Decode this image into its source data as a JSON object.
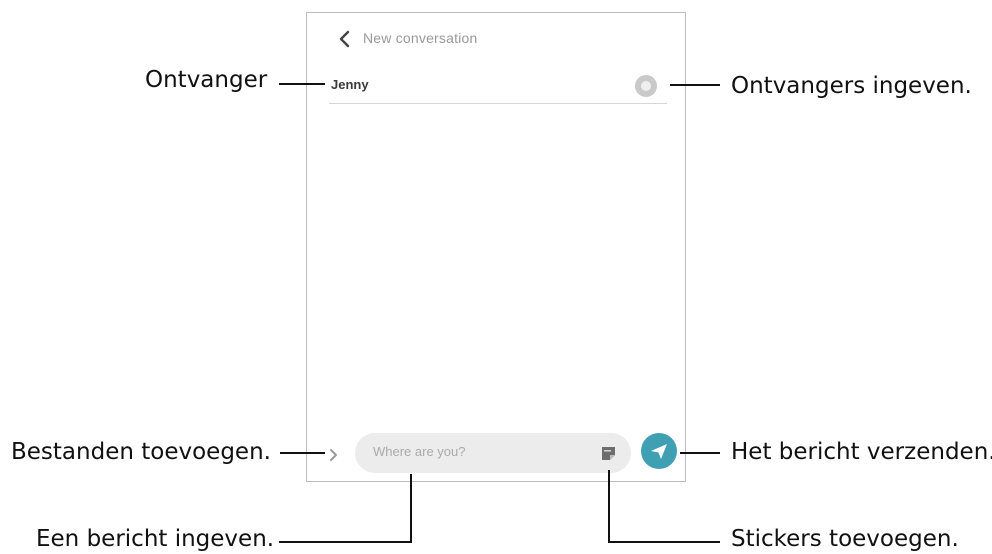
{
  "phone": {
    "title": "New conversation",
    "recipient": "Jenny",
    "message_placeholder": "Where are you?"
  },
  "callouts": {
    "recipient": "Ontvanger",
    "add_recipients": "Ontvangers ingeven.",
    "add_files": "Bestanden toevoegen.",
    "send": "Het bericht verzenden.",
    "enter_message": "Een bericht ingeven.",
    "add_stickers": "Stickers toevoegen."
  },
  "icons": {
    "back": "back-arrow-icon",
    "add_contact": "add-contact-icon",
    "expand": "chevron-right-icon",
    "sticker": "sticker-icon",
    "send": "send-icon"
  },
  "colors": {
    "send_button": "#3f9fb3",
    "input_background": "#ececec"
  }
}
